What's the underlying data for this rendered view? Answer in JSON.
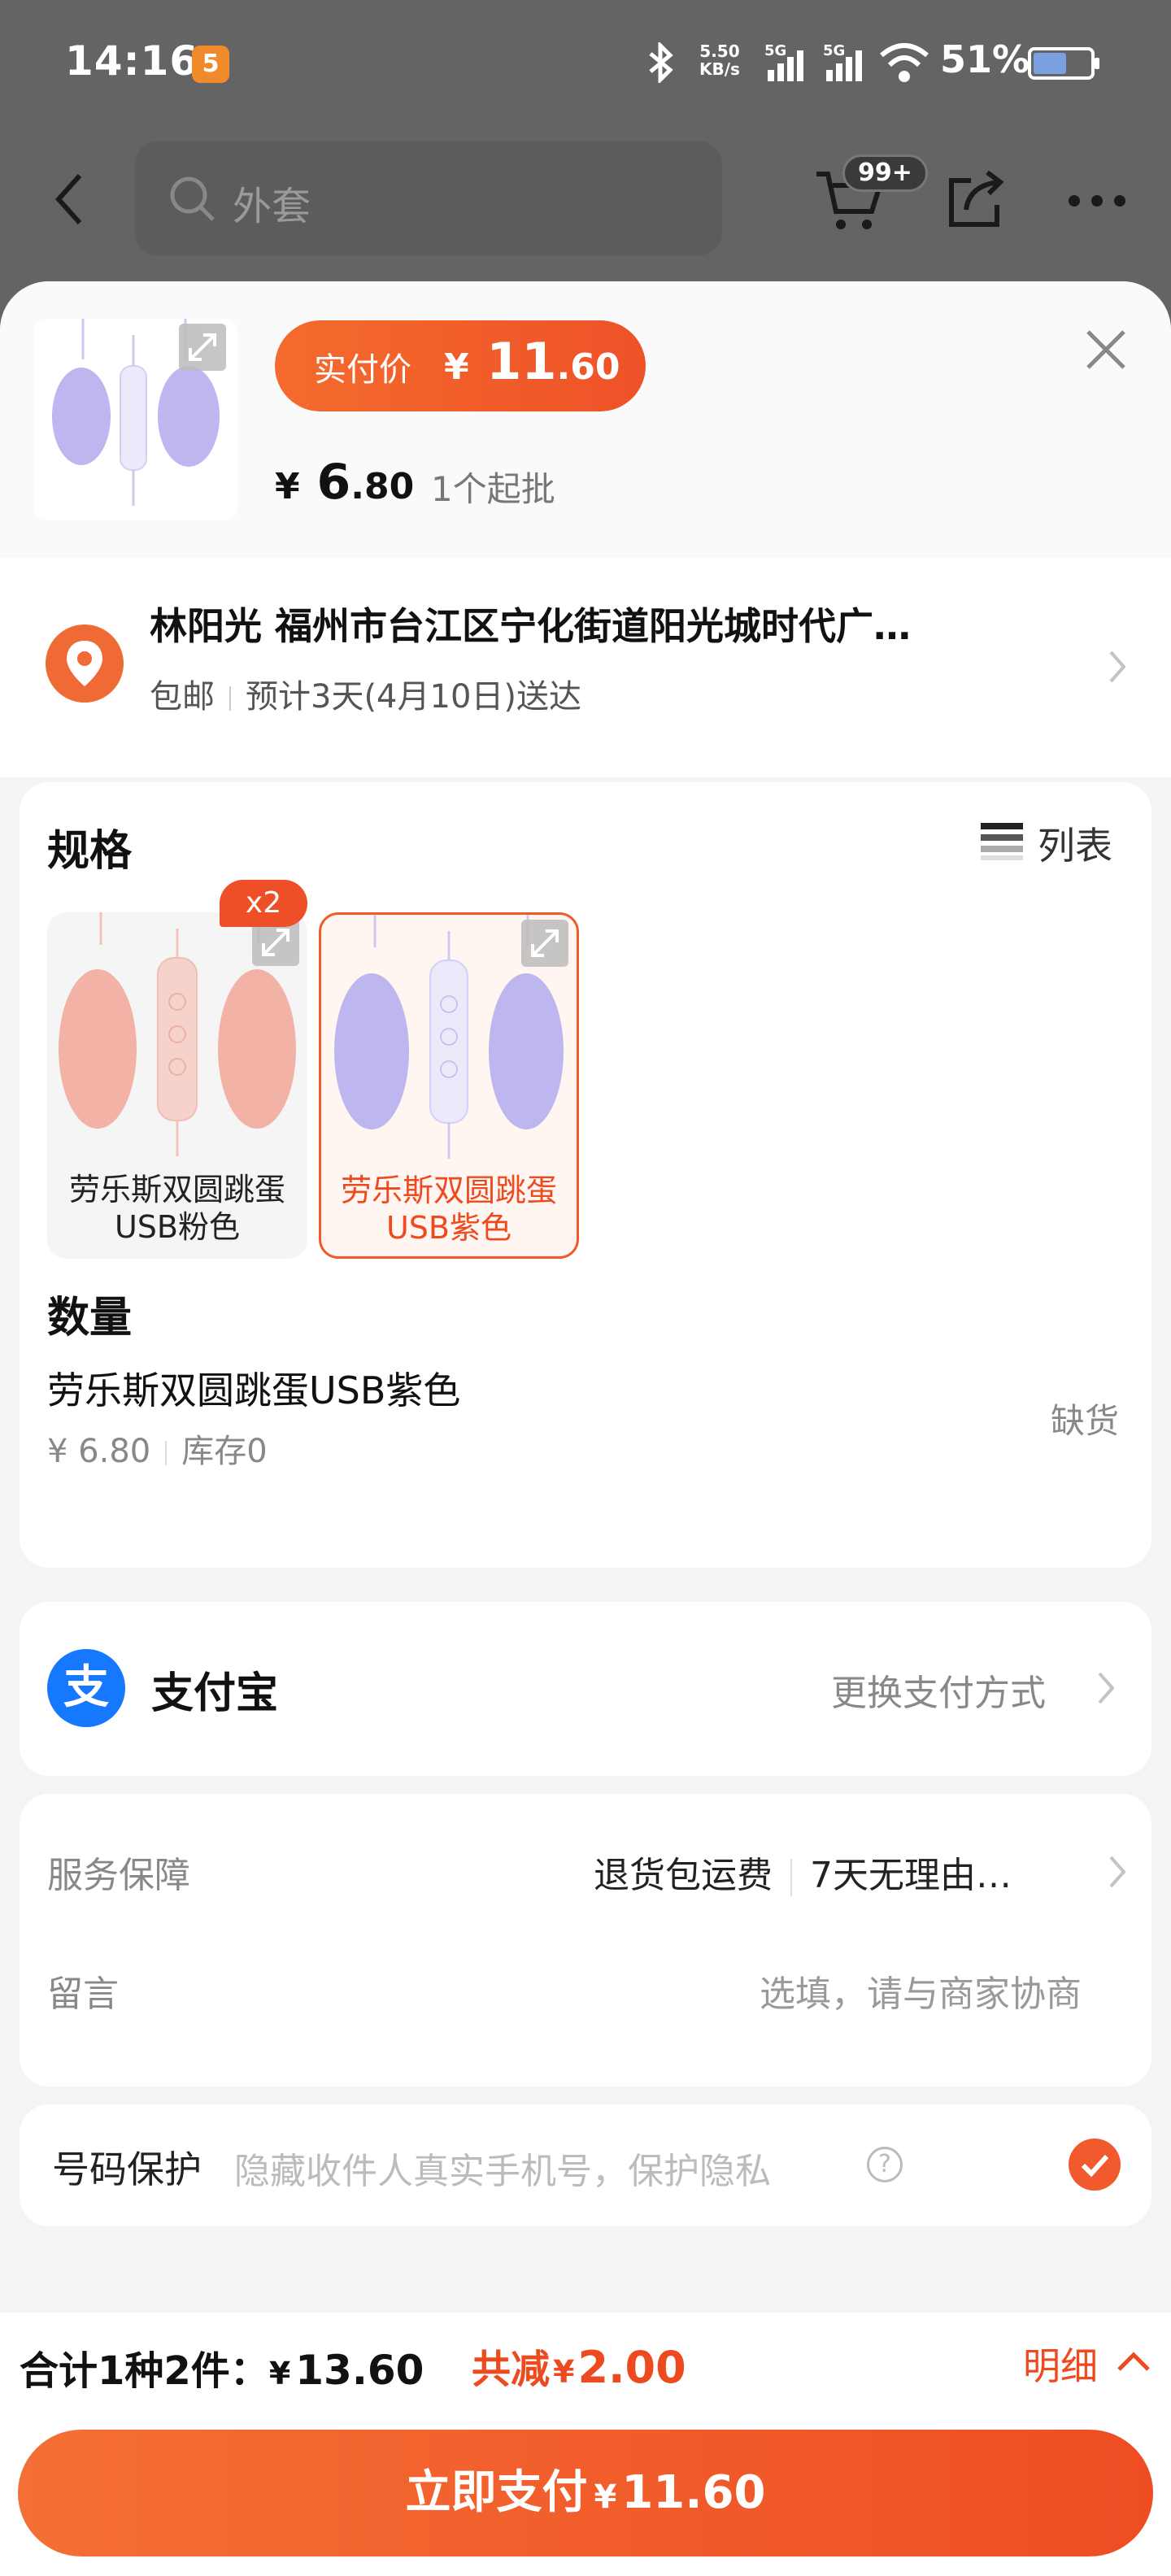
{
  "status_bar": {
    "time": "14:16",
    "app_badge": "5",
    "net_speed_value": "5.50",
    "net_speed_unit": "KB/s",
    "signal_1": "5G",
    "signal_2": "5G",
    "battery": "51%"
  },
  "background_nav": {
    "search_placeholder": "外套",
    "cart_badge": "99+"
  },
  "product": {
    "pay_price_label": "实付价",
    "pay_price_currency": "¥",
    "pay_price_int": "11",
    "pay_price_dec": ".60",
    "unit_price_currency": "¥",
    "unit_price_int": "6",
    "unit_price_dec": ".80",
    "min_order": "1个起批"
  },
  "address": {
    "name_line": "林阳光 福州市台江区宁化街道阳光城时代广…",
    "shipping": "包邮",
    "eta": "预计3天(4月10日)送达"
  },
  "spec": {
    "title": "规格",
    "list_label": "列表",
    "items": [
      {
        "name_line1": "劳乐斯双圆跳蛋",
        "name_line2": "USB粉色",
        "badge": "x2",
        "color": "#f2b3a6"
      },
      {
        "name_line1": "劳乐斯双圆跳蛋",
        "name_line2": "USB紫色",
        "color": "#bdb6ef"
      }
    ]
  },
  "quantity": {
    "title": "数量",
    "item_name": "劳乐斯双圆跳蛋USB紫色",
    "price": "¥ 6.80",
    "stock": "库存0",
    "status": "缺货"
  },
  "payment": {
    "method": "支付宝",
    "icon_char": "支",
    "change_label": "更换支付方式"
  },
  "service": {
    "label": "服务保障",
    "item1": "退货包运费",
    "item2": "7天无理由…",
    "message_label": "留言",
    "message_placeholder": "选填，请与商家协商"
  },
  "privacy": {
    "label": "号码保护",
    "desc": "隐藏收件人真实手机号，保护隐私"
  },
  "summary": {
    "total_label": "合计1种2件：",
    "total_currency": "¥",
    "total_value": "13.60",
    "discount_label": "共减",
    "discount_currency": "¥",
    "discount_value": "2.00",
    "detail_label": "明细"
  },
  "pay_button": {
    "label": "立即支付",
    "currency": "¥",
    "amount": "11.60"
  },
  "colors": {
    "accent": "#ee5228",
    "alipay_blue": "#1677ff",
    "sheet_bg": "#f4f4f4"
  }
}
